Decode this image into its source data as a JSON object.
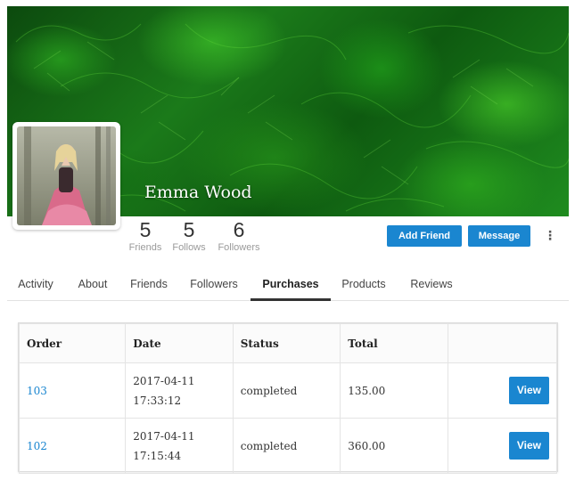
{
  "profile": {
    "name": "Emma Wood",
    "stats": [
      {
        "value": "5",
        "label": "Friends"
      },
      {
        "value": "5",
        "label": "Follows"
      },
      {
        "value": "6",
        "label": "Followers"
      }
    ]
  },
  "actions": {
    "add_friend": "Add Friend",
    "message": "Message",
    "more": "⋮"
  },
  "tabs": [
    {
      "label": "Activity",
      "active": false
    },
    {
      "label": "About",
      "active": false
    },
    {
      "label": "Friends",
      "active": false
    },
    {
      "label": "Followers",
      "active": false
    },
    {
      "label": "Purchases",
      "active": true
    },
    {
      "label": "Products",
      "active": false
    },
    {
      "label": "Reviews",
      "active": false
    }
  ],
  "purchases": {
    "columns": [
      "Order",
      "Date",
      "Status",
      "Total",
      ""
    ],
    "rows": [
      {
        "order": "103",
        "date": "2017-04-11",
        "time": "17:33:12",
        "status": "completed",
        "total": "135.00",
        "action": "View"
      },
      {
        "order": "102",
        "date": "2017-04-11",
        "time": "17:15:44",
        "status": "completed",
        "total": "360.00",
        "action": "View"
      }
    ]
  },
  "colors": {
    "accent": "#1a86d0",
    "cover": "#1b7a1a"
  }
}
